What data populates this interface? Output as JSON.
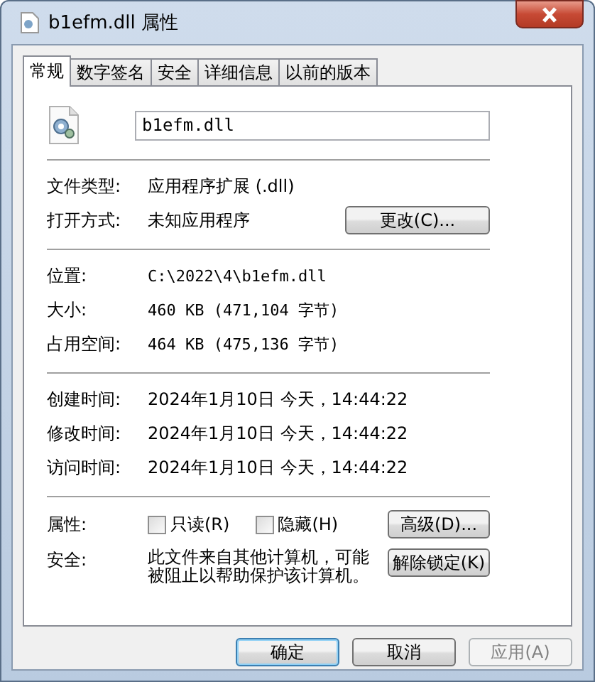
{
  "window": {
    "title": "b1efm.dll 属性"
  },
  "tabs": [
    {
      "label": "常规",
      "selected": true
    },
    {
      "label": "数字签名",
      "selected": false
    },
    {
      "label": "安全",
      "selected": false
    },
    {
      "label": "详细信息",
      "selected": false
    },
    {
      "label": "以前的版本",
      "selected": false
    }
  ],
  "file_name": {
    "value": "b1efm.dll"
  },
  "type_section": [
    {
      "label": "文件类型:",
      "value": "应用程序扩展 (.dll)"
    },
    {
      "label": "打开方式:",
      "value": "未知应用程序",
      "button": "更改(C)..."
    }
  ],
  "location_section": [
    {
      "label": "位置:",
      "value": "C:\\2022\\4\\b1efm.dll"
    },
    {
      "label": "大小:",
      "value": "460 KB (471,104 字节)"
    },
    {
      "label": "占用空间:",
      "value": "464 KB (475,136 字节)"
    }
  ],
  "time_section": [
    {
      "label": "创建时间:",
      "value": "2024年1月10日 今天，14:44:22"
    },
    {
      "label": "修改时间:",
      "value": "2024年1月10日 今天，14:44:22"
    },
    {
      "label": "访问时间:",
      "value": "2024年1月10日 今天，14:44:22"
    }
  ],
  "attributes": {
    "label": "属性:",
    "checkboxes": [
      {
        "label": "只读(R)",
        "checked": false
      },
      {
        "label": "隐藏(H)",
        "checked": false
      }
    ],
    "button": "高级(D)..."
  },
  "security": {
    "label": "安全:",
    "text": "此文件来自其他计算机，可能被阻止以帮助保护该计算机。",
    "button": "解除锁定(K)"
  },
  "buttons": [
    {
      "label": "确定",
      "focused": true,
      "disabled": false
    },
    {
      "label": "取消",
      "focused": false,
      "disabled": false
    },
    {
      "label": "应用(A)",
      "focused": false,
      "disabled": true
    }
  ]
}
